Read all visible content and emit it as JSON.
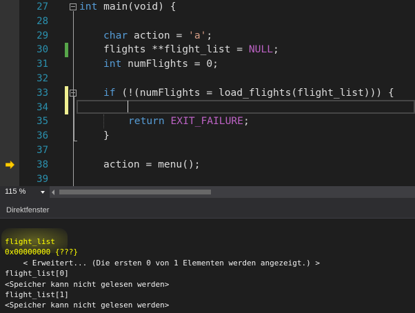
{
  "editor": {
    "lines": [
      {
        "num": "27",
        "code": "int main(void) {"
      },
      {
        "num": "28",
        "code": ""
      },
      {
        "num": "29",
        "code": "    char action = 'a';"
      },
      {
        "num": "30",
        "code": "    flights **flight_list = NULL;"
      },
      {
        "num": "31",
        "code": "    int numFlights = 0;"
      },
      {
        "num": "32",
        "code": ""
      },
      {
        "num": "33",
        "code": "    if (!(numFlights = load_flights(flight_list))) {"
      },
      {
        "num": "34",
        "code": ""
      },
      {
        "num": "35",
        "code": "        return EXIT_FAILURE;"
      },
      {
        "num": "36",
        "code": "    }"
      },
      {
        "num": "37",
        "code": ""
      },
      {
        "num": "38",
        "code": "    action = menu();"
      },
      {
        "num": "39",
        "code": ""
      }
    ],
    "tokens": {
      "l27_kw": "int",
      "l27_rest": " main(void) {",
      "l29_kw": "char",
      "l29_mid": " action = ",
      "l29_str": "'a'",
      "l29_end": ";",
      "l30_pre": "flights **flight_list = ",
      "l30_mac": "NULL",
      "l30_end": ";",
      "l31_kw": "int",
      "l31_rest": " numFlights = 0;",
      "l33_kw": "if",
      "l33_rest": " (!(numFlights = load_flights(flight_list))) {",
      "l35_kw": "return",
      "l35_sp": " ",
      "l35_mac": "EXIT_FAILURE",
      "l35_end": ";",
      "l36": "}",
      "l38": "action = menu();"
    },
    "colors": {
      "keyword": "#569cd6",
      "string": "#d69d85",
      "macro": "#bd63c5",
      "line_number": "#2b91af",
      "change_saved": "#57a64a",
      "change_unsaved": "#efef91",
      "execution_arrow": "#ffcc00"
    },
    "current_line": "34",
    "execution_line": "38"
  },
  "status": {
    "zoom": "115 %"
  },
  "immediate_window": {
    "title": "Direktfenster",
    "lines": [
      {
        "text": "flight_list",
        "style": "yellow"
      },
      {
        "text": "0x00000000 {???}",
        "style": "yellow"
      },
      {
        "text": "    < Erweitert... (Die ersten 0 von 1 Elementen werden angezeigt.) >",
        "style": "white"
      },
      {
        "text": "flight_list[0]",
        "style": "white"
      },
      {
        "text": "<Speicher kann nicht gelesen werden>",
        "style": "white"
      },
      {
        "text": "flight_list[1]",
        "style": "white"
      },
      {
        "text": "<Speicher kann nicht gelesen werden>",
        "style": "white"
      }
    ]
  }
}
